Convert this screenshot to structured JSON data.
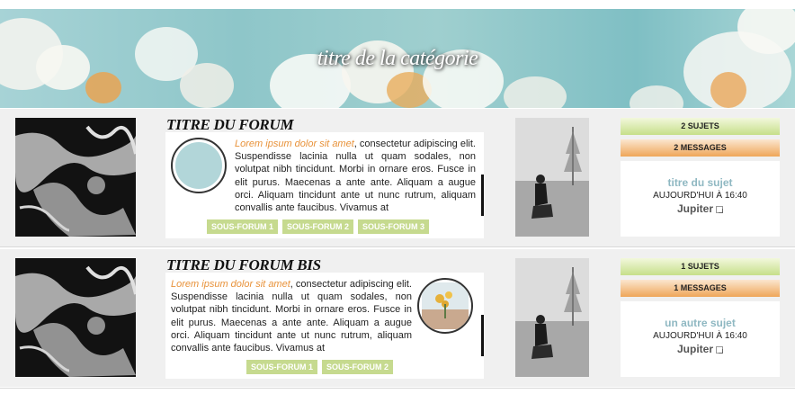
{
  "banner": {
    "title": "titre de la catégorie"
  },
  "forums": [
    {
      "title": "TITRE DU FORUM",
      "description_highlight": "Lorem ipsum dolor sit amet",
      "description_text": ", consectetur adipiscing elit. Suspendisse lacinia nulla ut quam sodales, non volutpat nibh tincidunt. Morbi in ornare eros. Fusce in elit purus. Maecenas a ante ante. Aliquam a augue orci. Aliquam tincidunt ante ut nunc rutrum, aliquam convallis ante faucibus. Vivamus at",
      "subforums": [
        "SOUS-FORUM 1",
        "SOUS-FORUM 2",
        "SOUS-FORUM 3"
      ],
      "topics": "2 SUJETS",
      "messages": "2 MESSAGES",
      "last_post": {
        "title": "titre du sujet",
        "date": "AUJOURD'HUI À 16:40",
        "user": "Jupiter"
      }
    },
    {
      "title": "TITRE DU FORUM BIS",
      "description_highlight": "Lorem ipsum dolor sit amet",
      "description_text": ", consectetur adipiscing elit. Suspendisse lacinia nulla ut quam sodales, non volutpat nibh tincidunt. Morbi in ornare eros. Fusce in elit purus. Maecenas a ante ante. Aliquam a augue orci. Aliquam tincidunt ante ut nunc rutrum, aliquam convallis ante faucibus. Vivamus at",
      "subforums": [
        "SOUS-FORUM 1",
        "SOUS-FORUM 2"
      ],
      "topics": "1 SUJETS",
      "messages": "1 MESSAGES",
      "last_post": {
        "title": "un autre sujet",
        "date": "AUJOURD'HUI À 16:40",
        "user": "Jupiter"
      }
    }
  ],
  "icons": {
    "goto": "goto-last-post-icon"
  }
}
